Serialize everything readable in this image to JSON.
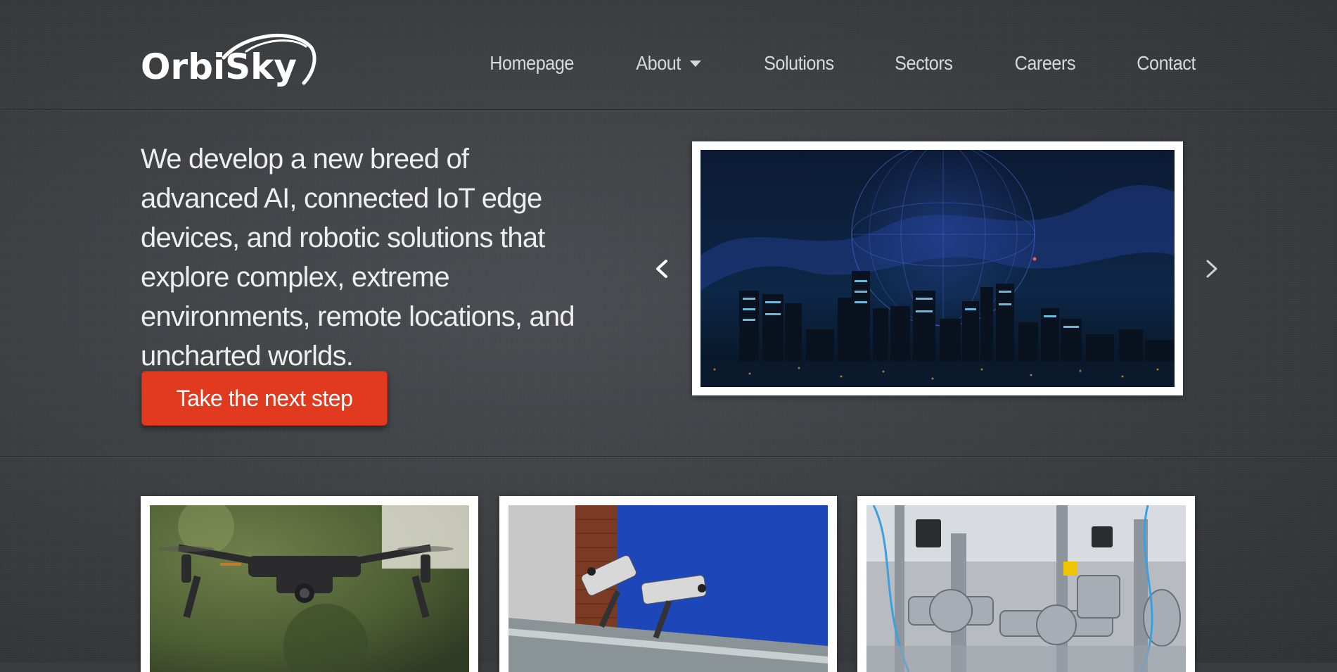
{
  "brand": {
    "logo_text": "OrbiSky",
    "logo_icon": "orbit-swoosh"
  },
  "nav": {
    "items": [
      {
        "label": "Homepage"
      },
      {
        "label": "About",
        "has_dropdown": true
      },
      {
        "label": "Solutions"
      },
      {
        "label": "Sectors"
      },
      {
        "label": "Careers"
      },
      {
        "label": "Contact"
      }
    ]
  },
  "hero": {
    "headline": "We develop a new breed of advanced AI, connected IoT edge devices, and robotic solutions that explore complex, extreme environments, remote locations, and uncharted worlds.",
    "cta_label": "Take the next step",
    "slider": {
      "prev_icon": "chevron-left-icon",
      "next_icon": "chevron-right-icon"
    }
  },
  "colors": {
    "background": "#3a3d40",
    "accent": "#e23a1e",
    "nav_text": "#d6d8d9"
  }
}
